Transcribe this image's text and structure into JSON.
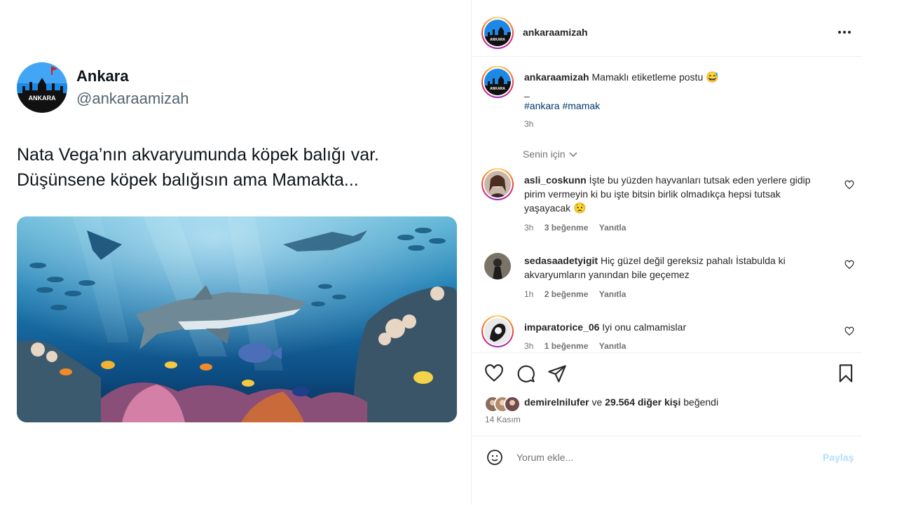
{
  "tweet": {
    "name": "Ankara",
    "handle": "@ankaraamizah",
    "text_line1": "Nata Vega’nın akvaryumunda köpek balığı var.",
    "text_line2": "Düşünsene köpek balığısın ama Mamakta...",
    "avatar_text": "ANKARA"
  },
  "instagram": {
    "header": {
      "username": "ankaraamizah",
      "more_icon": "more-horizontal-icon",
      "avatar_text": "ANKARA"
    },
    "caption": {
      "username": "ankaraamizah",
      "text": "Mamaklı etiketleme postu",
      "emoji": "😅",
      "separator": "_",
      "hashtags": "#ankara #mamak",
      "time": "3h"
    },
    "filter_label": "Senin için",
    "comments": [
      {
        "username": "asli_coskunn",
        "text": "İşte bu yüzden hayvanları tutsak eden yerlere gidip pirim vermeyin ki bu işte bitsin birlik olmadıkça hepsi tutsak yaşayacak",
        "emoji": "😟",
        "time": "3h",
        "likes": "3 beğenme",
        "reply": "Yanıtla"
      },
      {
        "username": "sedasaadetyigit",
        "text": "Hiç güzel değil gereksiz pahalı İstabulda ki akvaryumların yanından bile geçemez",
        "emoji": "",
        "time": "1h",
        "likes": "2 beğenme",
        "reply": "Yanıtla"
      },
      {
        "username": "imparatorice_06",
        "text": "Iyi onu calmamislar",
        "emoji": "",
        "time": "3h",
        "likes": "1 beğenme",
        "reply": "Yanıtla"
      }
    ],
    "actions": {
      "like_icon": "heart-icon",
      "comment_icon": "comment-icon",
      "share_icon": "share-icon",
      "save_icon": "bookmark-icon"
    },
    "likes": {
      "user": "demirelnilufer",
      "connector": "ve",
      "others": "29.564 diğer kişi",
      "suffix": "beğendi"
    },
    "date": "14 Kasım",
    "add_comment": {
      "placeholder": "Yorum ekle...",
      "post_label": "Paylaş"
    },
    "colors": {
      "link": "#00376b",
      "muted": "#737373",
      "post_disabled": "#b2dffc"
    }
  }
}
